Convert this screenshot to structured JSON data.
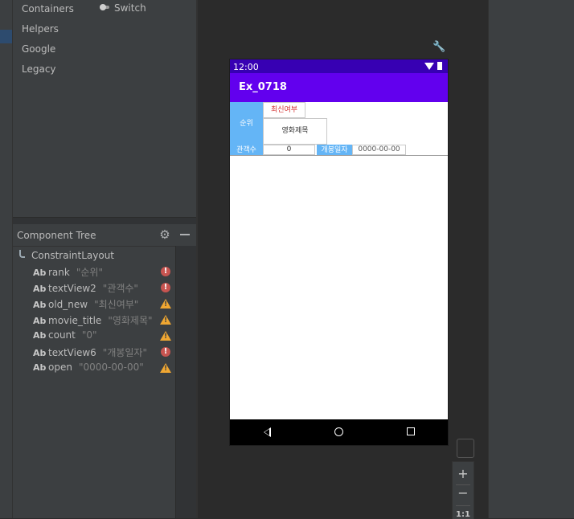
{
  "palette": {
    "categories": [
      "Containers",
      "Helpers",
      "Google",
      "Legacy"
    ],
    "items": [
      {
        "label": "Switch",
        "icon": "switch-icon"
      }
    ]
  },
  "component_tree": {
    "title": "Component Tree",
    "root": "ConstraintLayout",
    "items": [
      {
        "id": "rank",
        "text": "\"순위\"",
        "status": "error"
      },
      {
        "id": "textView2",
        "text": "\"관객수\"",
        "status": "error"
      },
      {
        "id": "old_new",
        "text": "\"최신여부\"",
        "status": "warning"
      },
      {
        "id": "movie_title",
        "text": "\"영화제목\"",
        "status": "warning"
      },
      {
        "id": "count",
        "text": "\"0\"",
        "status": "warning"
      },
      {
        "id": "textView6",
        "text": "\"개봉일자\"",
        "status": "error"
      },
      {
        "id": "open",
        "text": "\"0000-00-00\"",
        "status": "warning"
      }
    ]
  },
  "phone": {
    "time": "12:00",
    "app_title": "Ex_0718",
    "views": {
      "rank": "순위",
      "old_new": "최신여부",
      "movie_title": "영화제목",
      "textView2": "관객수",
      "count": "0",
      "textView6": "개봉일자",
      "open": "0000-00-00"
    }
  },
  "zoom": {
    "in": "+",
    "out": "−",
    "fit": "1:1"
  },
  "colors": {
    "status_bar": "#3700b3",
    "app_bar": "#6200ee",
    "label_bg": "#64b5f6",
    "error": "#c75450",
    "warning": "#f0a732"
  }
}
